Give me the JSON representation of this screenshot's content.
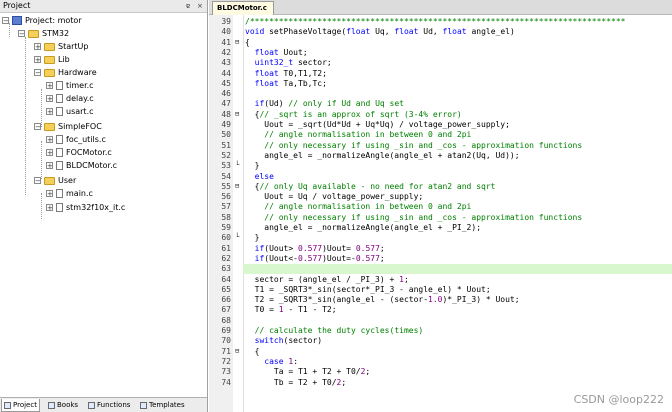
{
  "project_panel": {
    "title": "Project",
    "pin_glyph": "ɐ",
    "close_glyph": "×",
    "tree": [
      {
        "label": "Project: motor",
        "kind": "project"
      },
      {
        "label": "STM32",
        "kind": "folder"
      },
      {
        "label": "StartUp",
        "kind": "folder"
      },
      {
        "label": "Lib",
        "kind": "folder"
      },
      {
        "label": "Hardware",
        "kind": "folder"
      },
      {
        "label": "timer.c",
        "kind": "file"
      },
      {
        "label": "delay.c",
        "kind": "file"
      },
      {
        "label": "usart.c",
        "kind": "file"
      },
      {
        "label": "SimpleFOC",
        "kind": "folder"
      },
      {
        "label": "foc_utils.c",
        "kind": "file"
      },
      {
        "label": "FOCMotor.c",
        "kind": "file"
      },
      {
        "label": "BLDCMotor.c",
        "kind": "file"
      },
      {
        "label": "User",
        "kind": "folder"
      },
      {
        "label": "main.c",
        "kind": "file"
      },
      {
        "label": "stm32f10x_it.c",
        "kind": "file"
      }
    ],
    "tabs": [
      "Project",
      "Books",
      "Functions",
      "Templates"
    ]
  },
  "editor": {
    "tab_label": "BLDCMotor.c",
    "lines": [
      {
        "n": "39",
        "t": "/******************************************************************************"
      },
      {
        "n": "40",
        "t": "void setPhaseVoltage(float Uq, float Ud, float angle_el)"
      },
      {
        "n": "41",
        "t": "{"
      },
      {
        "n": "42",
        "t": "  float Uout;"
      },
      {
        "n": "43",
        "t": "  uint32_t sector;"
      },
      {
        "n": "44",
        "t": "  float T0,T1,T2;"
      },
      {
        "n": "45",
        "t": "  float Ta,Tb,Tc;"
      },
      {
        "n": "46",
        "t": ""
      },
      {
        "n": "47",
        "t": "  if(Ud) // only if Ud and Uq set"
      },
      {
        "n": "48",
        "t": "  {// _sqrt is an approx of sqrt (3-4% error)"
      },
      {
        "n": "49",
        "t": "    Uout = _sqrt(Ud*Ud + Uq*Uq) / voltage_power_supply;"
      },
      {
        "n": "50",
        "t": "    // angle normalisation in between 0 and 2pi"
      },
      {
        "n": "51",
        "t": "    // only necessary if using _sin and _cos - approximation functions"
      },
      {
        "n": "52",
        "t": "    angle_el = _normalizeAngle(angle_el + atan2(Uq, Ud));"
      },
      {
        "n": "53",
        "t": "  }"
      },
      {
        "n": "54",
        "t": "  else"
      },
      {
        "n": "55",
        "t": "  {// only Uq available - no need for atan2 and sqrt"
      },
      {
        "n": "56",
        "t": "    Uout = Uq / voltage_power_supply;"
      },
      {
        "n": "57",
        "t": "    // angle normalisation in between 0 and 2pi"
      },
      {
        "n": "58",
        "t": "    // only necessary if using _sin and _cos - approximation functions"
      },
      {
        "n": "59",
        "t": "    angle_el = _normalizeAngle(angle_el + _PI_2);"
      },
      {
        "n": "60",
        "t": "  }"
      },
      {
        "n": "61",
        "t": "  if(Uout> 0.577)Uout= 0.577;"
      },
      {
        "n": "62",
        "t": "  if(Uout<-0.577)Uout=-0.577;"
      },
      {
        "n": "63",
        "t": ""
      },
      {
        "n": "64",
        "t": "  sector = (angle_el / _PI_3) + 1;"
      },
      {
        "n": "65",
        "t": "  T1 = _SQRT3*_sin(sector*_PI_3 - angle_el) * Uout;"
      },
      {
        "n": "66",
        "t": "  T2 = _SQRT3*_sin(angle_el - (sector-1.0)*_PI_3) * Uout;"
      },
      {
        "n": "67",
        "t": "  T0 = 1 - T1 - T2;"
      },
      {
        "n": "68",
        "t": ""
      },
      {
        "n": "69",
        "t": "  // calculate the duty cycles(times)"
      },
      {
        "n": "70",
        "t": "  switch(sector)"
      },
      {
        "n": "71",
        "t": "  {"
      },
      {
        "n": "72",
        "t": "    case 1:"
      },
      {
        "n": "73",
        "t": "      Ta = T1 + T2 + T0/2;"
      },
      {
        "n": "74",
        "t": "      Tb = T2 + T0/2;"
      }
    ],
    "highlighted_line": "63"
  },
  "watermark": "CSDN @loop222"
}
